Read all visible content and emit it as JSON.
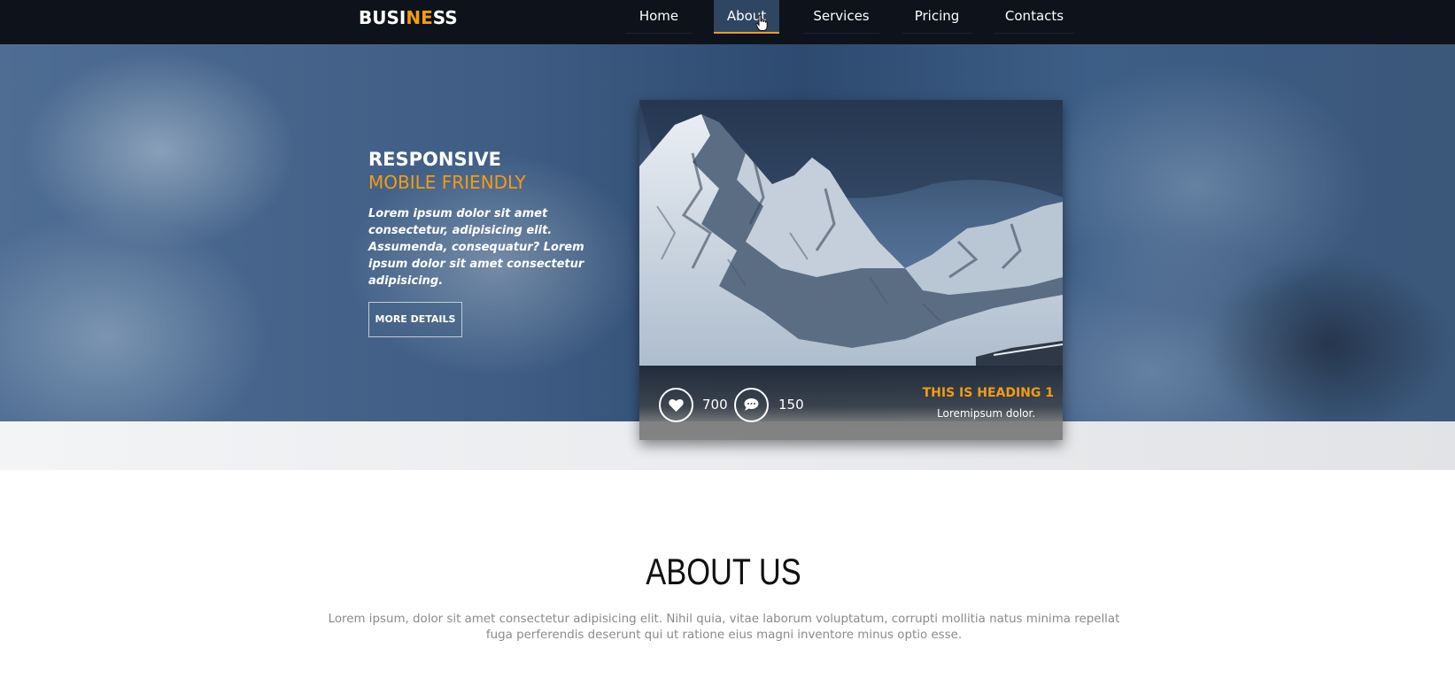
{
  "navbar": {
    "brand_part1": "BUSI",
    "brand_part2": "NE",
    "brand_part3": "SS",
    "items": [
      {
        "label": "Home"
      },
      {
        "label": "About"
      },
      {
        "label": "Services"
      },
      {
        "label": "Pricing"
      },
      {
        "label": "Contacts"
      }
    ],
    "active_item": "About"
  },
  "hero": {
    "title": "RESPONSIVE",
    "subtitle": "MOBILE FRIENDLY",
    "text": "Lorem ipsum dolor sit amet consectetur, adipisicing elit. Assumenda, consequatur? Lorem ipsum dolor sit amet consectetur adipisicing.",
    "button_label": "MORE DETAILS"
  },
  "card": {
    "likes_icon": "heart-icon",
    "likes": "700",
    "comments_icon": "speech-bubble-icon",
    "comments": "150",
    "heading": "THIS IS HEADING 1",
    "subtext": "Loremipsum dolor."
  },
  "about": {
    "title": "ABOUT US",
    "text": "Lorem ipsum, dolor sit amet consectetur adipisicing elit. Nihil quia, vitae laborum voluptatum, corrupti mollitia natus minima repellat fuga perferendis deserunt qui ut ratione eius magni inventore minus optio esse."
  },
  "colors": {
    "accent": "#f39c12",
    "navbar_bg": "#0d121b",
    "active_nav_bg": "#2f4663"
  }
}
